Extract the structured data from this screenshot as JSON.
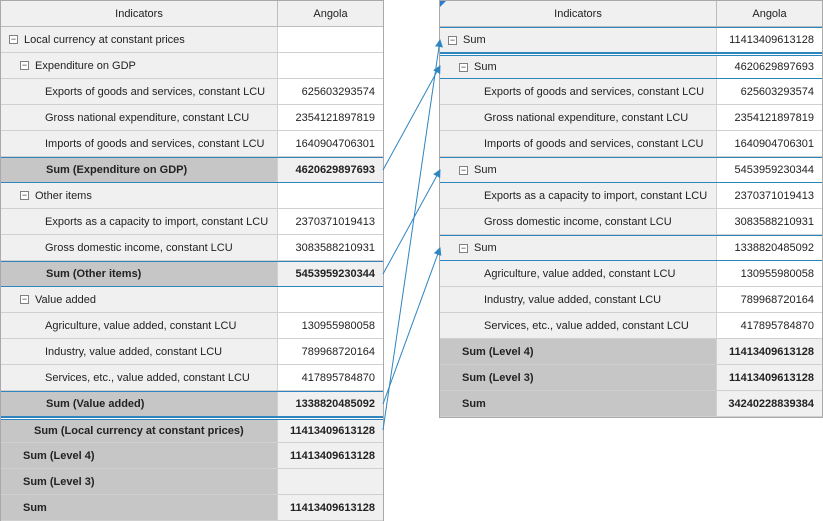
{
  "left": {
    "header": {
      "indicators": "Indicators",
      "country": "Angola"
    },
    "rows": [
      {
        "label": "Local currency at constant prices",
        "value": "",
        "kind": "group",
        "level": 0
      },
      {
        "label": "Expenditure on GDP",
        "value": "",
        "kind": "group",
        "level": 1
      },
      {
        "label": "Exports of goods and services, constant LCU",
        "value": "625603293574",
        "kind": "leaf"
      },
      {
        "label": "Gross national expenditure, constant LCU",
        "value": "2354121897819",
        "kind": "leaf"
      },
      {
        "label": "Imports of goods and services, constant LCU",
        "value": "1640904706301",
        "kind": "leaf"
      },
      {
        "label": "Sum (Expenditure on GDP)",
        "value": "4620629897693",
        "kind": "sum1"
      },
      {
        "label": "Other items",
        "value": "",
        "kind": "group",
        "level": 1
      },
      {
        "label": "Exports as a capacity to import, constant LCU",
        "value": "2370371019413",
        "kind": "leaf"
      },
      {
        "label": "Gross domestic income, constant LCU",
        "value": "3083588210931",
        "kind": "leaf"
      },
      {
        "label": "Sum (Other items)",
        "value": "5453959230344",
        "kind": "sum1"
      },
      {
        "label": "Value added",
        "value": "",
        "kind": "group",
        "level": 1
      },
      {
        "label": "Agriculture, value added, constant LCU",
        "value": "130955980058",
        "kind": "leaf"
      },
      {
        "label": "Industry, value added, constant LCU",
        "value": "789968720164",
        "kind": "leaf"
      },
      {
        "label": "Services, etc., value added, constant LCU",
        "value": "417895784870",
        "kind": "leaf"
      },
      {
        "label": "Sum (Value added)",
        "value": "1338820485092",
        "kind": "sum1"
      },
      {
        "label": "Sum (Local currency at constant prices)",
        "value": "11413409613128",
        "kind": "sum0"
      },
      {
        "label": "Sum (Level 4)",
        "value": "11413409613128",
        "kind": "sumr"
      },
      {
        "label": "Sum (Level 3)",
        "value": "",
        "kind": "sumr"
      },
      {
        "label": "Sum",
        "value": "11413409613128",
        "kind": "sumr"
      }
    ]
  },
  "right": {
    "header": {
      "indicators": "Indicators",
      "country": "Angola"
    },
    "rows": [
      {
        "label": "Sum",
        "value": "11413409613128",
        "kind": "group",
        "level": 0
      },
      {
        "label": "Sum",
        "value": "4620629897693",
        "kind": "group",
        "level": 1
      },
      {
        "label": "Exports of goods and services, constant LCU",
        "value": "625603293574",
        "kind": "leaf"
      },
      {
        "label": "Gross national expenditure, constant LCU",
        "value": "2354121897819",
        "kind": "leaf"
      },
      {
        "label": "Imports of goods and services, constant LCU",
        "value": "1640904706301",
        "kind": "leaf"
      },
      {
        "label": "Sum",
        "value": "5453959230344",
        "kind": "group",
        "level": 1
      },
      {
        "label": "Exports as a capacity to import, constant LCU",
        "value": "2370371019413",
        "kind": "leaf"
      },
      {
        "label": "Gross domestic income, constant LCU",
        "value": "3083588210931",
        "kind": "leaf"
      },
      {
        "label": "Sum",
        "value": "1338820485092",
        "kind": "group",
        "level": 1
      },
      {
        "label": "Agriculture, value added, constant LCU",
        "value": "130955980058",
        "kind": "leaf"
      },
      {
        "label": "Industry, value added, constant LCU",
        "value": "789968720164",
        "kind": "leaf"
      },
      {
        "label": "Services, etc., value added, constant LCU",
        "value": "417895784870",
        "kind": "leaf"
      },
      {
        "label": "Sum (Level 4)",
        "value": "11413409613128",
        "kind": "sumr"
      },
      {
        "label": "Sum (Level 3)",
        "value": "11413409613128",
        "kind": "sumr"
      },
      {
        "label": "Sum",
        "value": "34240228839384",
        "kind": "sumr"
      }
    ]
  },
  "colors": {
    "connector": "#2e85c0",
    "sum_row": "#c6c6c6",
    "header": "#f0f0f0"
  },
  "icons": {
    "collapse": "collapse-minus-icon"
  }
}
